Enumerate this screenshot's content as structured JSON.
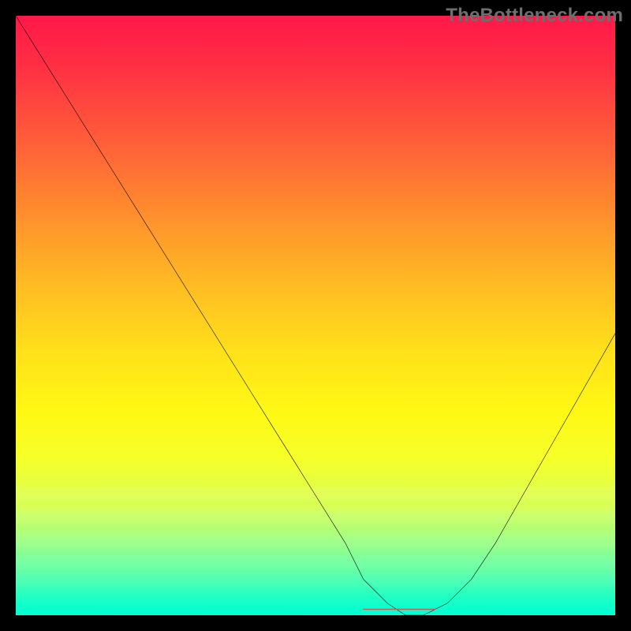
{
  "watermark": "TheBottleneck.com",
  "colors": {
    "frame": "#000000",
    "curve": "#000000",
    "flat_segment": "#cc5a52"
  },
  "chart_data": {
    "type": "line",
    "title": "",
    "xlabel": "",
    "ylabel": "",
    "xlim": [
      0,
      100
    ],
    "ylim": [
      0,
      100
    ],
    "grid": false,
    "series": [
      {
        "name": "bottleneck-curve",
        "x": [
          0,
          5,
          10,
          15,
          20,
          25,
          30,
          35,
          40,
          45,
          50,
          55,
          58,
          62,
          65,
          68,
          72,
          76,
          80,
          84,
          88,
          92,
          96,
          100
        ],
        "y": [
          100,
          92,
          84,
          76,
          68,
          60,
          52,
          44,
          36,
          28,
          20,
          12,
          6,
          2,
          0,
          0,
          2,
          6,
          12,
          19,
          26,
          33,
          40,
          47
        ]
      },
      {
        "name": "optimal-flat-zone",
        "x": [
          58,
          70
        ],
        "y": [
          0,
          0
        ]
      }
    ],
    "minimum_x": 66,
    "minimum_y": 0
  }
}
